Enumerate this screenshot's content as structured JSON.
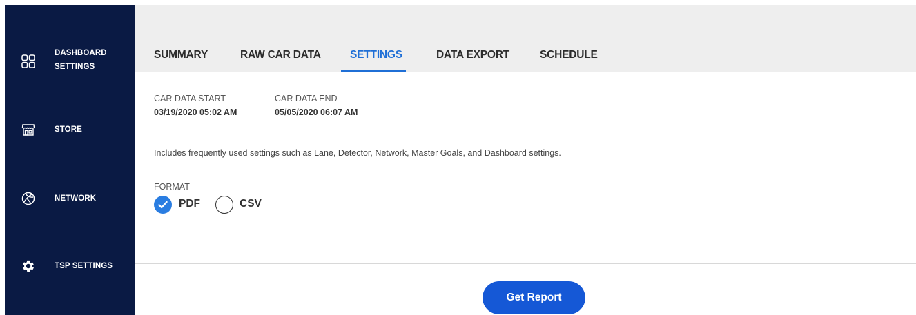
{
  "sidebar": {
    "items": [
      {
        "label_line1": "DASHBOARD",
        "label_line2": "SETTINGS",
        "icon": "grid-icon"
      },
      {
        "label": "STORE",
        "icon": "store-icon"
      },
      {
        "label": "NETWORK",
        "icon": "network-icon"
      },
      {
        "label": "TSP SETTINGS",
        "icon": "gear-icon"
      }
    ]
  },
  "tabs": [
    {
      "label": "SUMMARY",
      "active": false
    },
    {
      "label": "RAW CAR DATA",
      "active": false
    },
    {
      "label": "SETTINGS",
      "active": true
    },
    {
      "label": "DATA EXPORT",
      "active": false
    },
    {
      "label": "SCHEDULE",
      "active": false
    }
  ],
  "car_data": {
    "start_label": "CAR DATA START",
    "start_value": "03/19/2020 05:02 AM",
    "end_label": "CAR DATA END",
    "end_value": "05/05/2020 06:07 AM"
  },
  "description": "Includes frequently used settings such as Lane, Detector, Network, Master Goals, and Dashboard settings.",
  "format": {
    "label": "FORMAT",
    "options": [
      {
        "label": "PDF",
        "selected": true
      },
      {
        "label": "CSV",
        "selected": false
      }
    ]
  },
  "actions": {
    "get_report_label": "Get Report"
  },
  "colors": {
    "sidebar_bg": "#0a1a44",
    "accent": "#1f6fd6",
    "button_bg": "#1558d6",
    "radio_checked": "#2a7de1",
    "topbar_bg": "#eeeeee"
  }
}
